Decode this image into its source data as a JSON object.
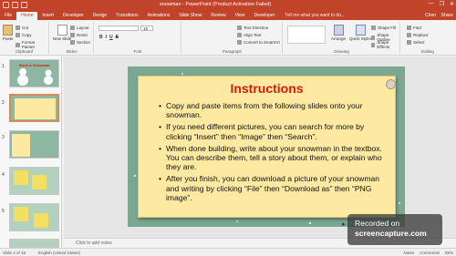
{
  "window": {
    "title": "snowman - PowerPoint (Product Activation Failed)",
    "controls": [
      "—",
      "❐",
      "✕"
    ]
  },
  "ribbon_tabs": {
    "file": "File",
    "home": "Home",
    "insert": "Insert",
    "developer1": "Developer",
    "design": "Design",
    "transitions": "Transitions",
    "animations": "Animations",
    "slideshow": "Slide Show",
    "review": "Review",
    "view": "View",
    "developer2": "Developer",
    "tellme": "Tell me what you want to do...",
    "user": "Chen",
    "share": "Share"
  },
  "clipboard": {
    "paste": "Paste",
    "cut": "Cut",
    "copy": "Copy",
    "format_painter": "Format Painter",
    "label": "Clipboard"
  },
  "slides_group": {
    "new_slide": "New Slide",
    "layout": "Layout",
    "reset": "Reset",
    "section": "Section",
    "label": "Slides"
  },
  "font_group": {
    "font_name": "",
    "font_size": "18",
    "bold": "B",
    "italic": "I",
    "underline": "U",
    "strike": "S",
    "label": "Font"
  },
  "paragraph_group": {
    "text_direction": "Text Direction",
    "align_text": "Align Text",
    "smartart": "Convert to SmartArt",
    "label": "Paragraph"
  },
  "drawing_group": {
    "arrange": "Arrange",
    "quick_styles": "Quick Styles",
    "shape_fill": "Shape Fill",
    "shape_outline": "Shape Outline",
    "shape_effects": "Shape Effects",
    "label": "Drawing"
  },
  "editing_group": {
    "find": "Find",
    "replace": "Replace",
    "select": "Select",
    "label": "Editing"
  },
  "thumbnails": {
    "numbers": [
      "1",
      "2",
      "3",
      "4",
      "5"
    ],
    "slide1_title": "Build A Snowman"
  },
  "slide": {
    "title": "Instructions",
    "bullets": [
      "Copy and paste items from the following slides onto your snowman.",
      "If you need different pictures, you can search for more by clicking “Insert” then “Image” then “Search”.",
      "When done building, write about your snowman in the textbox. You can describe them, tell a story about them, or explain who they are.",
      "After you finish, you can download a picture of your snowman and writing by clicking “File” then “Download as” then “PNG image”."
    ]
  },
  "notes": {
    "placeholder": "Click to add notes"
  },
  "status": {
    "slide_info": "Slide 2 of 18",
    "language": "English (United States)",
    "notes": "Notes",
    "comments": "Comments",
    "zoom": "85%"
  },
  "watermark": {
    "line1": "Recorded on",
    "line2": "screencapture.com"
  },
  "colors": {
    "accent": "#c1442a",
    "slide_bg": "#7ba792",
    "card": "#fde9a2",
    "title_red": "#d11a0a"
  }
}
